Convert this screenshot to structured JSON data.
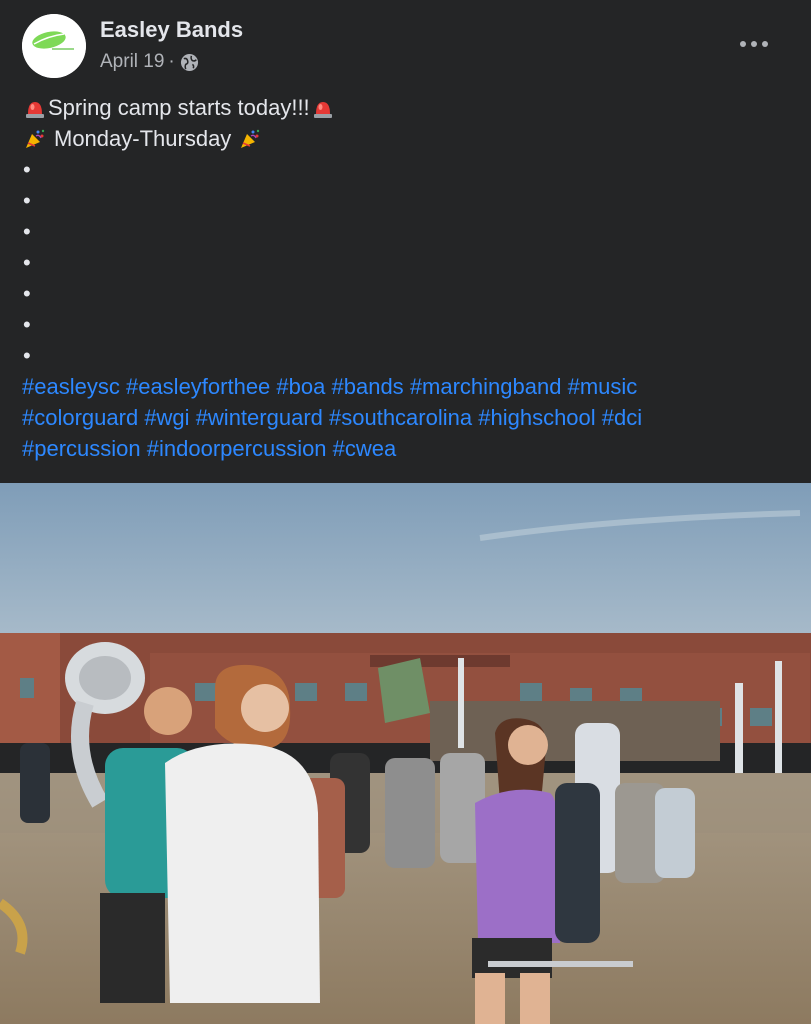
{
  "post": {
    "author": "Easley Bands",
    "date": "April 19",
    "separator": "·",
    "audience_icon": "globe-icon",
    "more_icon": "more-options-icon",
    "line1": "Spring camp starts today!!!",
    "line1_emoji": "rotating-light-emoji",
    "line2": "Monday-Thursday",
    "line2_emoji": "party-popper-emoji",
    "bullets": [
      "•",
      "•",
      "•",
      "•",
      "•",
      "•",
      "•"
    ],
    "hashtags": [
      "#easleysc",
      "#easleyforthee",
      "#boa",
      "#bands",
      "#marchingband",
      "#music",
      "#colorguard",
      "#wgi",
      "#winterguard",
      "#southcarolina",
      "#highschool",
      "#dci",
      "#percussion",
      "#indoorpercussion",
      "#cwea"
    ],
    "photo": "marching-band-rehearsal-photo"
  },
  "colors": {
    "background": "#242526",
    "text": "#e4e6eb",
    "secondary_text": "#b0b3b8",
    "link": "#2d88ff"
  }
}
